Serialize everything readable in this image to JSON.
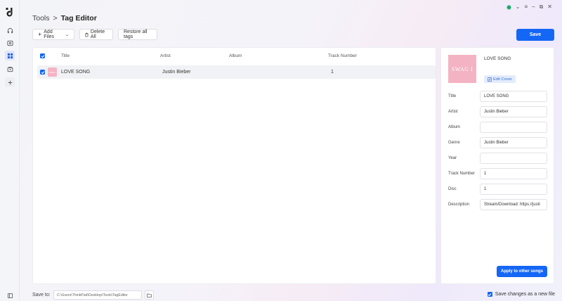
{
  "app": {
    "window_controls": [
      "⌄",
      "≡",
      "–",
      "⧉",
      "✕"
    ]
  },
  "breadcrumb": {
    "parent": "Tools",
    "separator": ">",
    "current": "Tag Editor"
  },
  "toolbar": {
    "add_files": "Add Files",
    "delete_all": "Delete All",
    "restore_all": "Restore all tags",
    "save": "Save"
  },
  "table": {
    "columns": [
      "Title",
      "Artist",
      "Album",
      "Track Number"
    ],
    "rows": [
      {
        "title": "LOVE SONG",
        "artist": "Justin Bieber",
        "album": "",
        "track": "1",
        "checked": true
      }
    ]
  },
  "editor": {
    "song_title": "LOVE SONG",
    "cover_text": "SWAG I",
    "edit_cover": "Edit Cover",
    "fields": [
      {
        "label": "Title",
        "value": "LOVE SONG"
      },
      {
        "label": "Artist",
        "value": "Justin Bieber"
      },
      {
        "label": "Album",
        "value": ""
      },
      {
        "label": "Genre",
        "value": "Justin Bieber"
      },
      {
        "label": "Year",
        "value": ""
      },
      {
        "label": "Track Number",
        "value": "1"
      },
      {
        "label": "Disc",
        "value": "1"
      },
      {
        "label": "Description",
        "value": "Stream/Download: https://justi"
      }
    ],
    "apply": "Apply to other songs"
  },
  "footer": {
    "save_to": "Save to:",
    "path": "C:\\Users\\ThinkPad\\Desktop\\Tools\\TagEditor",
    "save_new": "Save changes as a new file",
    "save_new_checked": true
  },
  "colors": {
    "accent": "#1466f5",
    "cover": "#f3b3c3",
    "status": "#18a36b"
  }
}
